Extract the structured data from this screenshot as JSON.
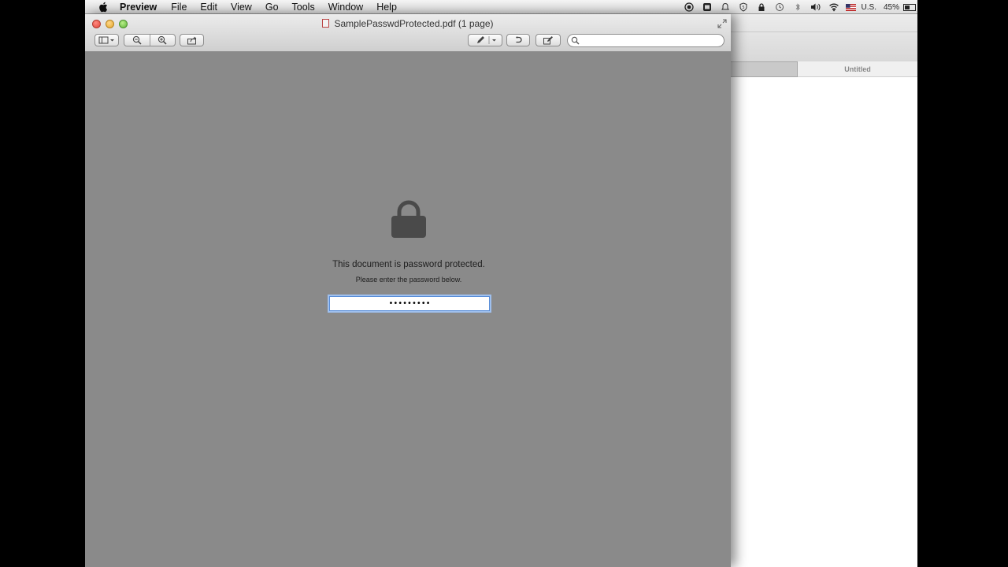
{
  "menubar": {
    "apple_icon": "apple-logo-icon",
    "app_name": "Preview",
    "items": [
      "File",
      "Edit",
      "View",
      "Go",
      "Tools",
      "Window",
      "Help"
    ],
    "status": {
      "icons": [
        "record-icon",
        "dropbox-icon",
        "notification-icon",
        "shield-icon",
        "lock-icon",
        "time-machine-icon",
        "bluetooth-icon",
        "volume-icon",
        "wifi-icon",
        "flag-icon"
      ],
      "input_source": "U.S.",
      "battery": "45%"
    }
  },
  "window": {
    "title": "SamplePasswdProtected.pdf (1 page)",
    "search": {
      "value": "",
      "placeholder": ""
    }
  },
  "background_window": {
    "tab_label": "Untitled"
  },
  "prompt": {
    "title": "This document is password protected.",
    "subtitle": "Please enter the password below.",
    "password_value": "•••••••••"
  },
  "colors": {
    "desktop_gray": "#8a8a8a",
    "focus_ring": "#5a8ed8",
    "lock_color": "#4a4a4a"
  }
}
